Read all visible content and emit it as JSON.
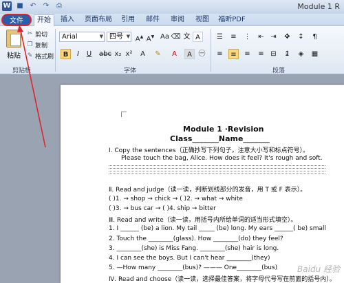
{
  "window": {
    "title": "Module 1 R"
  },
  "tabs": {
    "file": "文件",
    "home": "开始",
    "insert": "插入",
    "page_layout": "页面布局",
    "references": "引用",
    "mailings": "邮件",
    "review": "审阅",
    "view": "视图",
    "foxit_pdf": "福昕PDF"
  },
  "clipboard": {
    "paste": "粘贴",
    "cut": "剪切",
    "copy": "复制",
    "format_painter": "格式刷",
    "group_label": "剪贴板"
  },
  "font": {
    "name": "Arial",
    "size": "四号",
    "group_label": "字体"
  },
  "paragraph": {
    "group_label": "段落"
  },
  "doc": {
    "title": "Module 1 ·Revision",
    "class_line": "Class_______Name_______",
    "s1": "Ⅰ. Copy the sentences（正确抄写下列句子，注意大小写和标点符号）。",
    "s1_text": "Please touch the bag, Alice. How does it feel? It's rough and soft.",
    "s2": "Ⅱ. Read and judge（读一读，判断划线部分的发音，用 T 或 F 表示）。",
    "s2_row1": "(     )1. → shop → chick → (     )2. → what → white",
    "s2_row2": "(     )3. → bus    car → (     )4. ship → bitter",
    "s3": "Ⅲ. Read and write（读一读，用括号内所给单词的适当形式填空）。",
    "q1": "1. I ______ (be) a lion. My tail _____ (be) long. My ears ______( be) small",
    "q2": "2. Touch the ________(glass). How ________(do) they feel?",
    "q3": "3. ________(she) is Miss Fang. ________(she) hair is long.",
    "q4": "4. I can see the boys. But I can't hear ________(they)",
    "q5": "5. —How many ________(bus)? ——— One________(bus)",
    "s4": "Ⅳ. Read and choose（读一读，选择最佳答案，将字母代号写在前面的括号内）。"
  },
  "watermark": "Baidu 经验"
}
